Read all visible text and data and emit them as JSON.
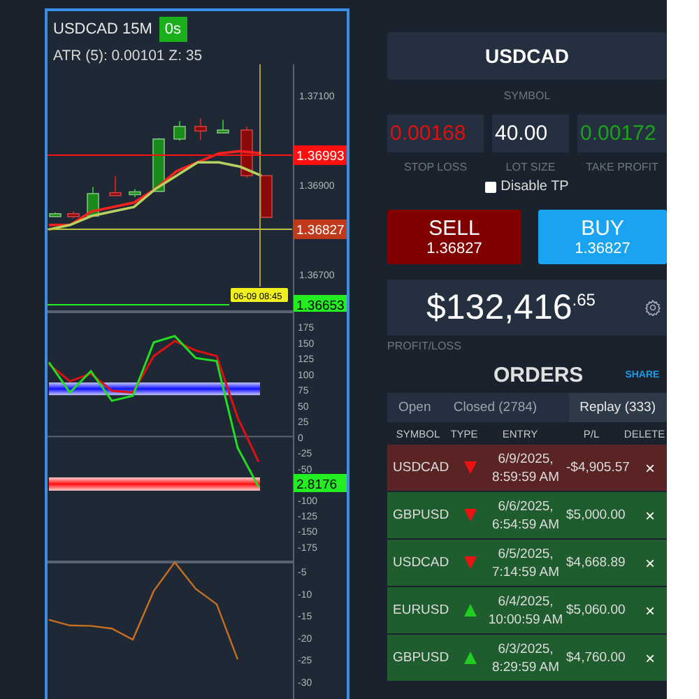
{
  "chart_header": {
    "title": "USDCAD 15M",
    "timer": "0s",
    "indicator": "ATR (5): 0.00101  Z: 35"
  },
  "price_chart": {
    "chart_data": {
      "type": "line",
      "ylim": [
        1.36616,
        1.37169
      ],
      "yticks": [
        {
          "value": 1.371,
          "label": "1.37100"
        },
        {
          "value": 1.369,
          "label": "1.36900"
        },
        {
          "value": 1.367,
          "label": "1.36700"
        }
      ],
      "series": [
        {
          "color": "#ff2020",
          "values": [
            1.3681,
            1.3681,
            1.3684,
            1.3685,
            1.3686,
            1.3689,
            1.3693,
            1.3695,
            1.3697,
            1.36975,
            1.3697
          ]
        },
        {
          "color": "#b8d060",
          "values": [
            1.368,
            1.3681,
            1.3683,
            1.3684,
            1.3685,
            1.3689,
            1.3692,
            1.3695,
            1.3695,
            1.3694,
            1.3692
          ]
        }
      ]
    },
    "tags": [
      {
        "text": "1.36993",
        "color": "#ff1010"
      },
      {
        "text": "1.36827",
        "color": "#c0391b"
      },
      {
        "text": "1.36653",
        "color": "#22ee22"
      }
    ],
    "time_tag": "06-09 08:45"
  },
  "oscillator": {
    "value_tag": "2.8176",
    "chart_data": {
      "type": "line",
      "ylim": [
        -199.5,
        198.6
      ],
      "yticks": [
        175,
        150,
        125,
        100,
        75,
        50,
        25,
        0,
        -25,
        -50,
        -100,
        -125,
        -150,
        -175
      ],
      "series": [
        {
          "color": "#e01010",
          "values": [
            115,
            88,
            100,
            73,
            70,
            128,
            152,
            137,
            128,
            30,
            -40
          ]
        },
        {
          "color": "#22dd22",
          "values": [
            118,
            70,
            104,
            57,
            65,
            150,
            160,
            125,
            120,
            -18,
            -80
          ]
        }
      ]
    }
  },
  "lower_chart": {
    "chart_data": {
      "type": "line",
      "ylim": [
        -34.1,
        -2.94
      ],
      "yticks": [
        -5,
        -10,
        -15,
        -20,
        -25,
        -30
      ],
      "series": [
        {
          "color": "#c87020",
          "values": [
            -16,
            -17.3,
            -17.4,
            -18,
            -20.5,
            -9.5,
            -3,
            -9,
            -12.5,
            -25,
            null
          ]
        }
      ]
    }
  },
  "trade_panel": {
    "symbol": "USDCAD",
    "symbol_label": "SYMBOL",
    "fields": [
      {
        "value": "0.00168",
        "label": "STOP LOSS",
        "color": "#e01010"
      },
      {
        "value": "40.00",
        "label": "LOT SIZE",
        "color": "#ffffff"
      },
      {
        "value": "0.00172",
        "label": "TAKE PROFIT",
        "color": "#1aa31a"
      }
    ],
    "disable_tp": {
      "label": "Disable TP",
      "checked": false
    },
    "sell": {
      "label": "SELL",
      "price": "1.36827"
    },
    "buy": {
      "label": "BUY",
      "price": "1.36827"
    },
    "profit": {
      "whole": "$132,416",
      "cents": ".65",
      "label": "PROFIT/LOSS"
    }
  },
  "orders": {
    "title": "ORDERS",
    "share": "SHARE",
    "tabs": [
      {
        "label": "Open",
        "selected": false
      },
      {
        "label": "Closed (2784)",
        "selected": false
      },
      {
        "label": "Replay (333)",
        "selected": true
      }
    ],
    "columns": [
      "SYMBOL",
      "TYPE",
      "ENTRY",
      "P/L",
      "DELETE"
    ],
    "rows": [
      {
        "symbol": "USDCAD",
        "kind": "sell",
        "entry": "6/9/2025, 8:59:59 AM",
        "pl": "-$4,905.57",
        "delete": "×",
        "color": "#5a2424"
      },
      {
        "symbol": "GBPUSD",
        "kind": "sell",
        "entry": "6/6/2025, 6:54:59 AM",
        "pl": "$5,000.00",
        "delete": "×",
        "color": "#1f5c2e"
      },
      {
        "symbol": "USDCAD",
        "kind": "sell",
        "entry": "6/5/2025, 7:14:59 AM",
        "pl": "$4,668.89",
        "delete": "×",
        "color": "#1f5c2e"
      },
      {
        "symbol": "EURUSD",
        "kind": "buy",
        "entry": "6/4/2025, 10:00:59 AM",
        "pl": "$5,060.00",
        "delete": "×",
        "color": "#1f5c2e"
      },
      {
        "symbol": "GBPUSD",
        "kind": "buy",
        "entry": "6/3/2025, 8:29:59 AM",
        "pl": "$4,760.00",
        "delete": "×",
        "color": "#1f5c2e"
      }
    ]
  }
}
